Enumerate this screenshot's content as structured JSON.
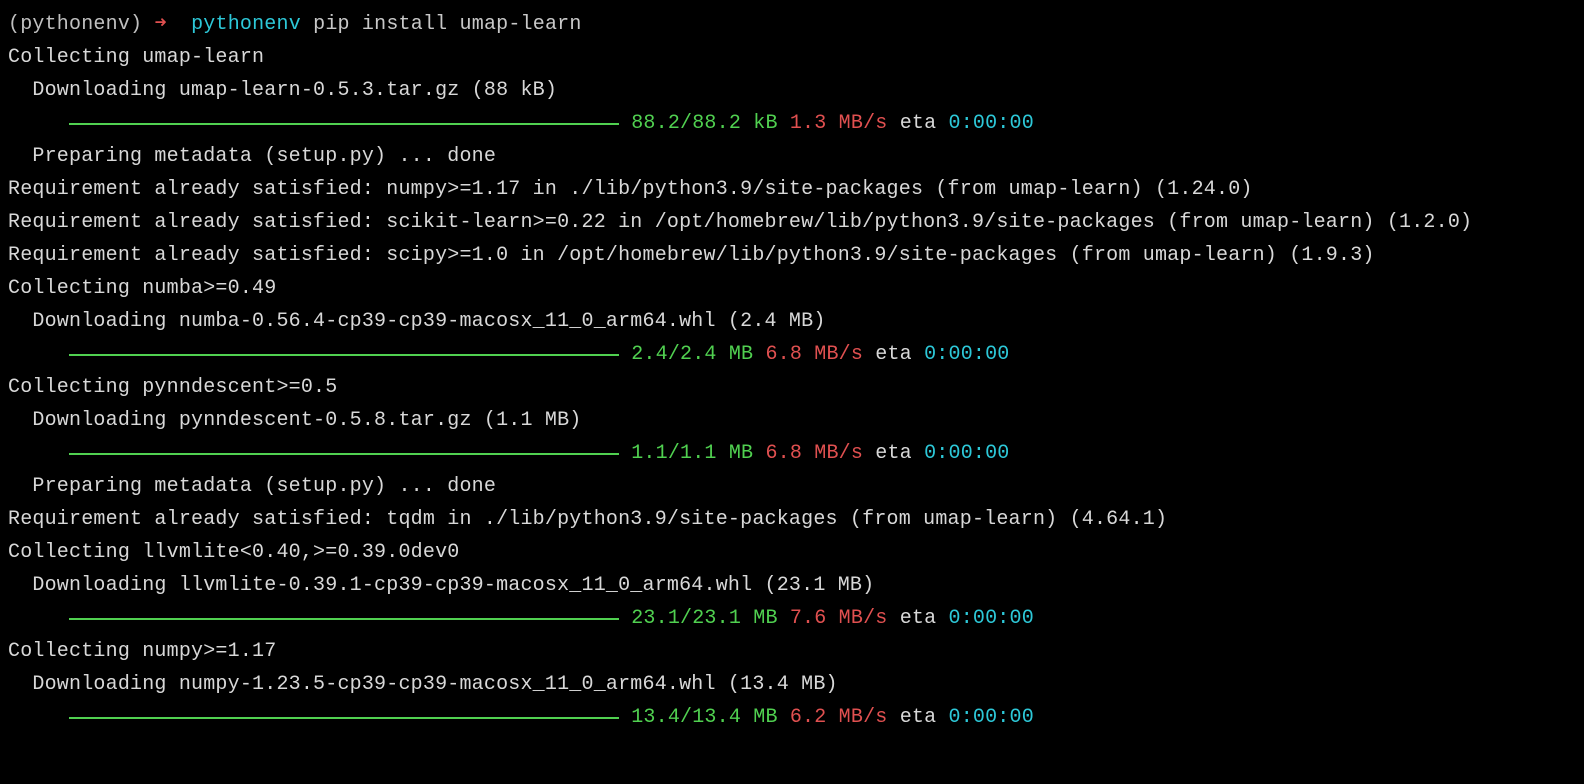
{
  "prompt": {
    "venv": "(pythonenv)",
    "arrow": "➜",
    "cwd": "pythonenv",
    "command": "pip install umap-learn"
  },
  "lines": [
    {
      "type": "plain",
      "text": "Collecting umap-learn"
    },
    {
      "type": "indent",
      "text": "Downloading umap-learn-0.5.3.tar.gz (88 kB)"
    },
    {
      "type": "progress",
      "size": "88.2/88.2 kB",
      "speed": "1.3 MB/s",
      "eta_label": "eta",
      "eta": "0:00:00"
    },
    {
      "type": "indent",
      "text": "Preparing metadata (setup.py) ... done"
    },
    {
      "type": "plain",
      "text": "Requirement already satisfied: numpy>=1.17 in ./lib/python3.9/site-packages (from umap-learn) (1.24.0)"
    },
    {
      "type": "plain",
      "text": "Requirement already satisfied: scikit-learn>=0.22 in /opt/homebrew/lib/python3.9/site-packages (from umap-learn) (1.2.0)"
    },
    {
      "type": "plain",
      "text": "Requirement already satisfied: scipy>=1.0 in /opt/homebrew/lib/python3.9/site-packages (from umap-learn) (1.9.3)"
    },
    {
      "type": "plain",
      "text": "Collecting numba>=0.49"
    },
    {
      "type": "indent",
      "text": "Downloading numba-0.56.4-cp39-cp39-macosx_11_0_arm64.whl (2.4 MB)"
    },
    {
      "type": "progress",
      "size": "2.4/2.4 MB",
      "speed": "6.8 MB/s",
      "eta_label": "eta",
      "eta": "0:00:00"
    },
    {
      "type": "plain",
      "text": "Collecting pynndescent>=0.5"
    },
    {
      "type": "indent",
      "text": "Downloading pynndescent-0.5.8.tar.gz (1.1 MB)"
    },
    {
      "type": "progress",
      "size": "1.1/1.1 MB",
      "speed": "6.8 MB/s",
      "eta_label": "eta",
      "eta": "0:00:00"
    },
    {
      "type": "indent",
      "text": "Preparing metadata (setup.py) ... done"
    },
    {
      "type": "plain",
      "text": "Requirement already satisfied: tqdm in ./lib/python3.9/site-packages (from umap-learn) (4.64.1)"
    },
    {
      "type": "plain",
      "text": "Collecting llvmlite<0.40,>=0.39.0dev0"
    },
    {
      "type": "indent",
      "text": "Downloading llvmlite-0.39.1-cp39-cp39-macosx_11_0_arm64.whl (23.1 MB)"
    },
    {
      "type": "progress",
      "size": "23.1/23.1 MB",
      "speed": "7.6 MB/s",
      "eta_label": "eta",
      "eta": "0:00:00"
    },
    {
      "type": "plain",
      "text": "Collecting numpy>=1.17"
    },
    {
      "type": "indent",
      "text": "Downloading numpy-1.23.5-cp39-cp39-macosx_11_0_arm64.whl (13.4 MB)"
    },
    {
      "type": "progress",
      "size": "13.4/13.4 MB",
      "speed": "6.2 MB/s",
      "eta_label": "eta",
      "eta": "0:00:00"
    }
  ]
}
